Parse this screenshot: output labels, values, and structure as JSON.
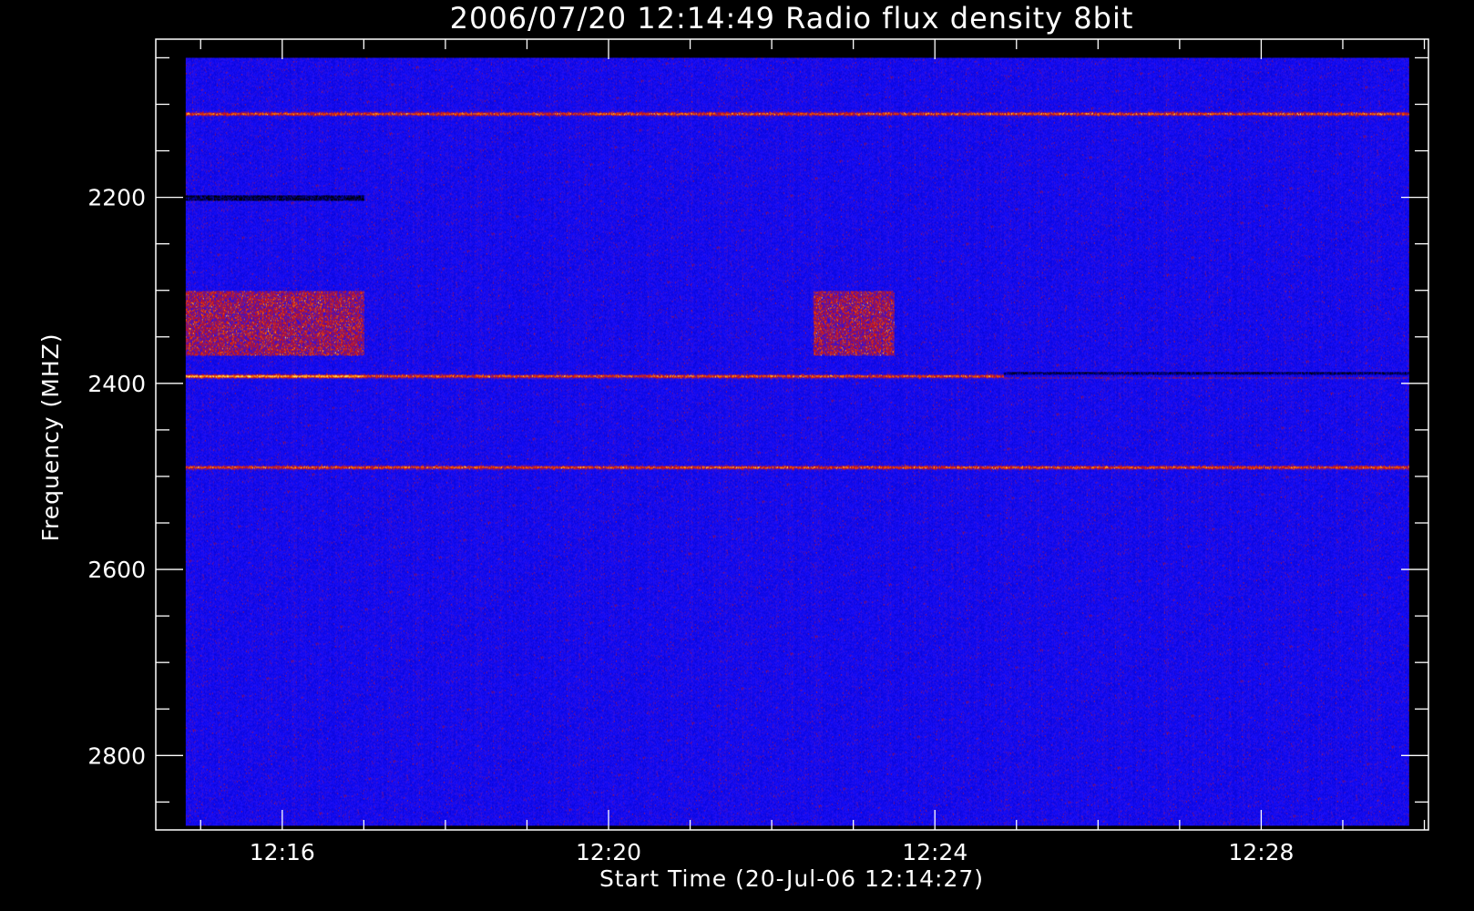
{
  "chart_data": {
    "type": "heatmap",
    "title": "2006/07/20 12:14:49 Radio flux density 8bit",
    "xlabel": "Start Time (20-Jul-06 12:14:27)",
    "ylabel": "Frequency (MHZ)",
    "x_ticks": [
      "12:16",
      "12:20",
      "12:24",
      "12:28"
    ],
    "y_ticks": [
      "2200",
      "2400",
      "2600",
      "2800"
    ],
    "x_range": [
      "12:14:27",
      "12:30:03"
    ],
    "y_range": [
      2030,
      2880
    ],
    "y_inverted": true,
    "data_time_range": [
      "12:14:49",
      "12:29:49"
    ],
    "data_freq_range": [
      2050,
      2876
    ],
    "colormap": [
      "#000000",
      "#0000c8",
      "#1a10ff",
      "#cc1010",
      "#ff8800",
      "#ffff80"
    ],
    "background_level": "blue",
    "features": [
      {
        "kind": "emission line",
        "freq": 2392,
        "time": [
          "12:14:49",
          "12:29:49"
        ],
        "strongest": [
          "12:14:49",
          "12:17:00"
        ]
      },
      {
        "kind": "emission line",
        "freq": 2490,
        "time": [
          "12:14:49",
          "12:29:49"
        ]
      },
      {
        "kind": "emission line",
        "freq": 2110,
        "time": [
          "12:14:49",
          "12:29:49"
        ]
      },
      {
        "kind": "absorption line",
        "freq": 2200,
        "time": [
          "12:14:49",
          "12:17:00"
        ]
      },
      {
        "kind": "absorption line",
        "freq": 2390,
        "time": [
          "12:24:50",
          "12:29:49"
        ]
      },
      {
        "kind": "enhanced band",
        "freq": [
          2300,
          2370
        ],
        "time": [
          "12:14:49",
          "12:17:00"
        ]
      },
      {
        "kind": "enhanced band",
        "freq": [
          2300,
          2370
        ],
        "time": [
          "12:22:30",
          "12:23:30"
        ]
      }
    ]
  }
}
